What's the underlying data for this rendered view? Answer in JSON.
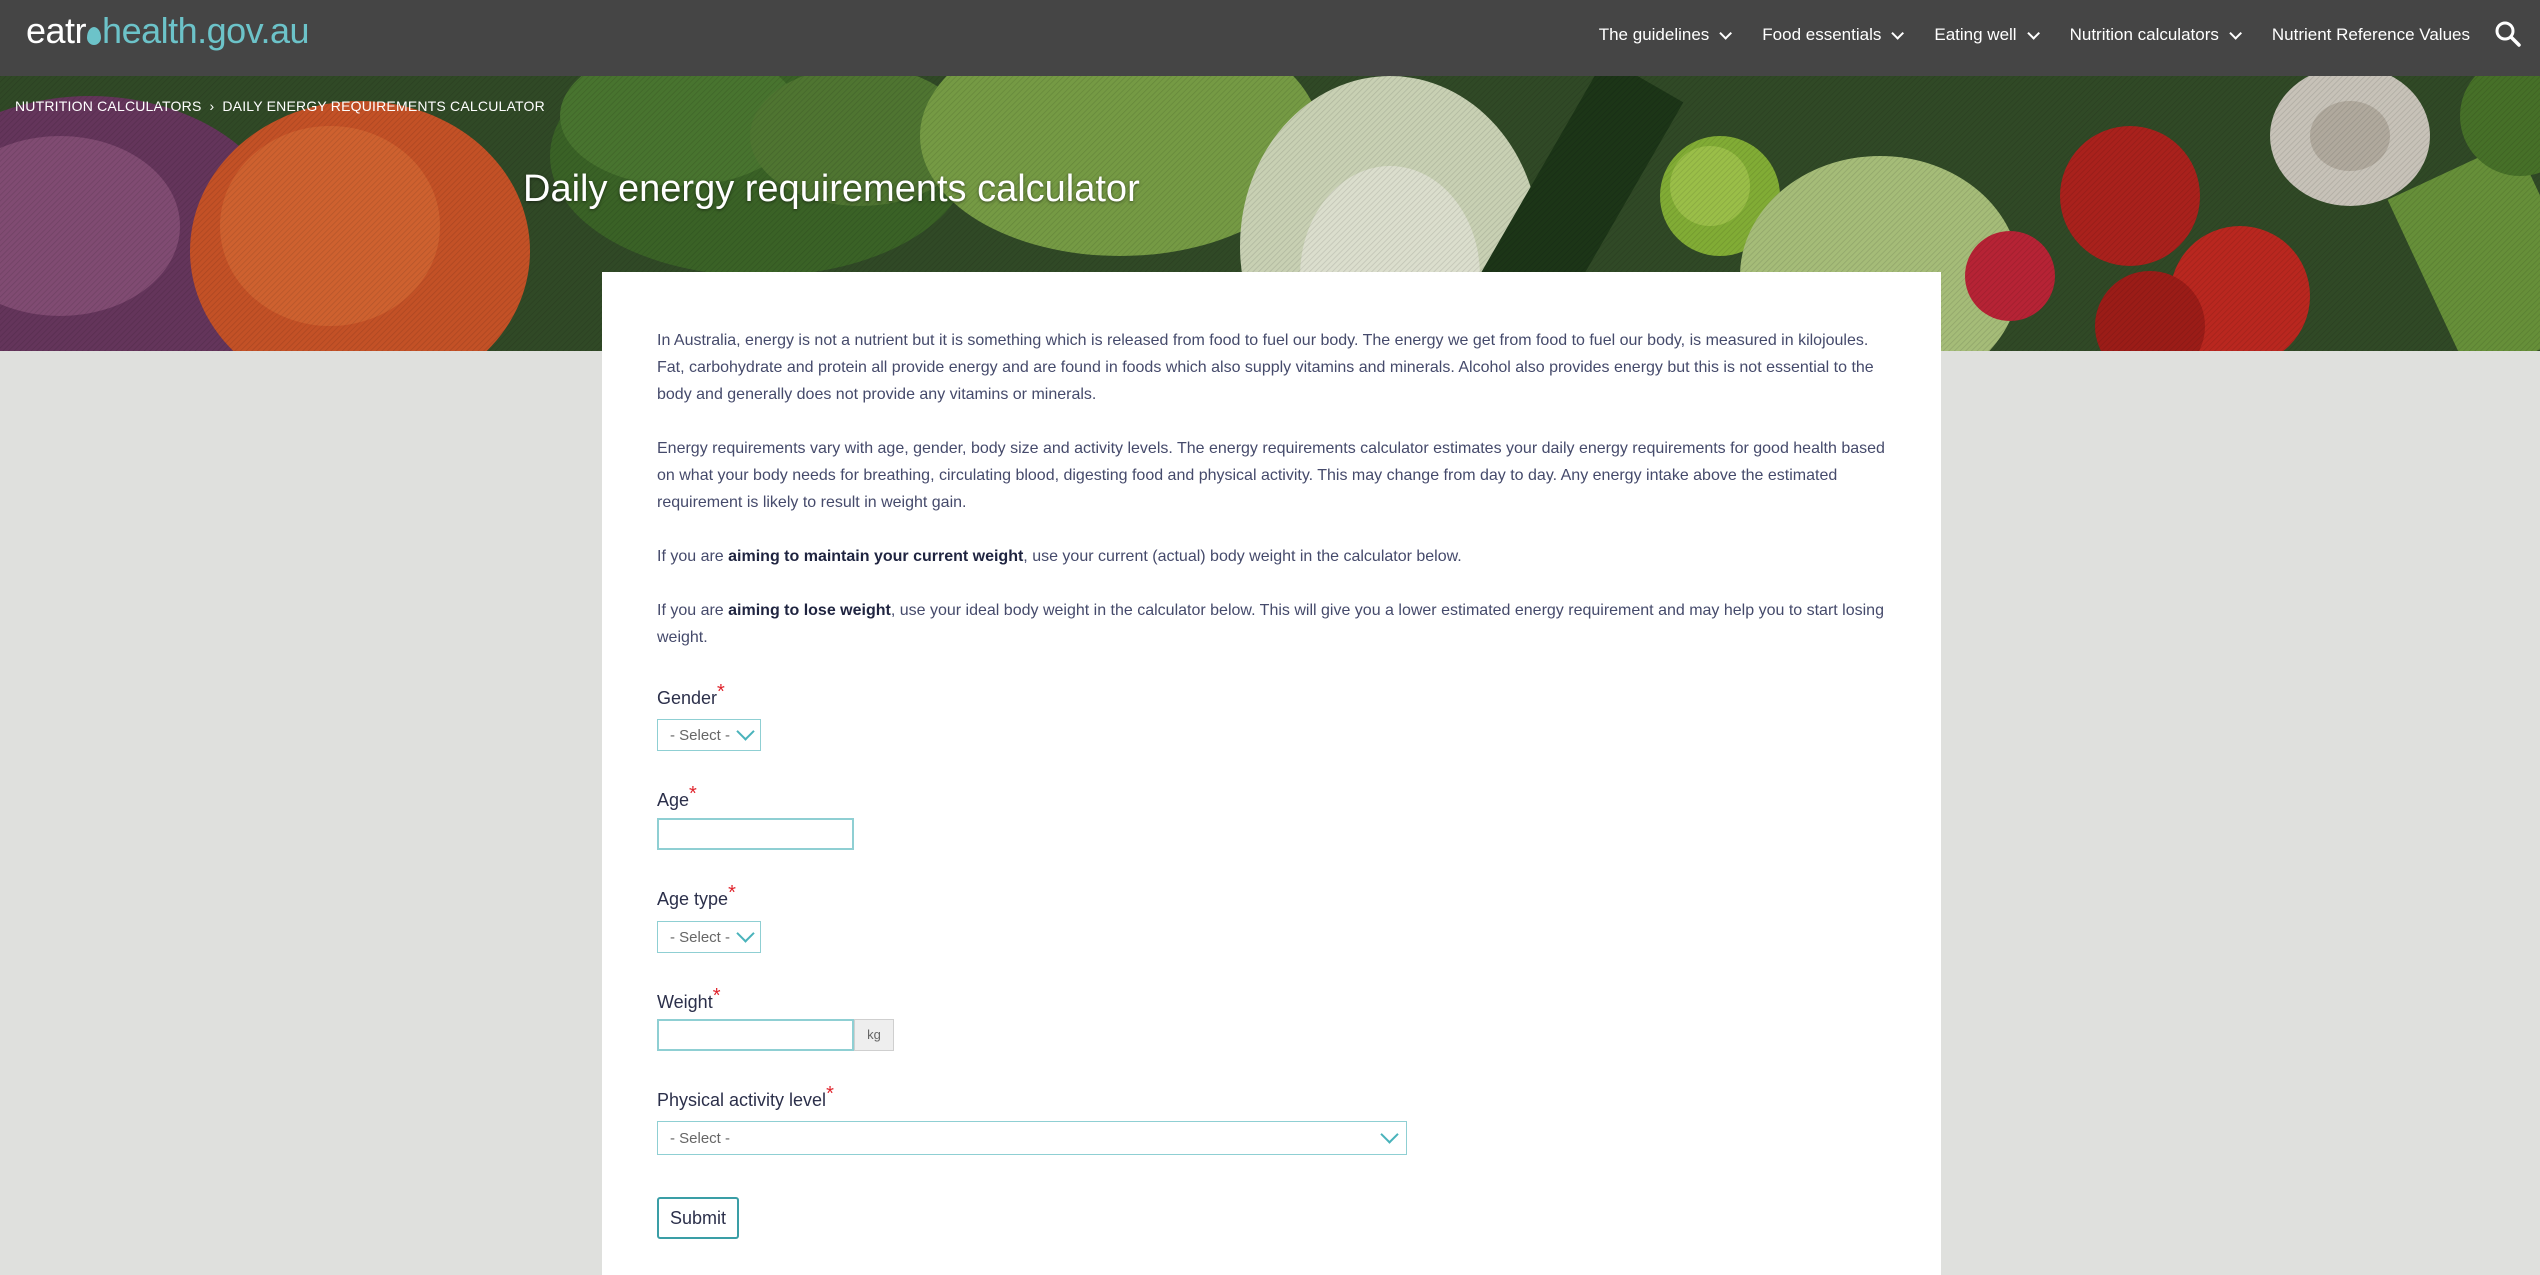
{
  "logo": {
    "part1": "eat",
    "part2": "r",
    "part3": "health.gov.au"
  },
  "nav": {
    "items": [
      {
        "label": "The guidelines"
      },
      {
        "label": "Food essentials"
      },
      {
        "label": "Eating well"
      },
      {
        "label": "Nutrition calculators"
      },
      {
        "label": "Nutrient Reference Values"
      }
    ],
    "search_icon": "search-icon"
  },
  "breadcrumb": {
    "items": [
      "NUTRITION CALCULATORS",
      "DAILY ENERGY REQUIREMENTS CALCULATOR"
    ],
    "separator": "›"
  },
  "page_title": "Daily energy requirements calculator",
  "intro": {
    "p1": "In Australia, energy is not a nutrient but it is something which is released from food to fuel our body. The energy we get from food to fuel our body, is measured in kilojoules. Fat, carbohydrate and protein all provide energy and are found in foods which also supply vitamins and minerals. Alcohol also provides energy but this is not essential to the body and generally does not provide any vitamins or minerals.",
    "p2": "Energy requirements vary with age, gender, body size and activity levels. The energy requirements calculator estimates your daily energy requirements for good health based on what your body needs for breathing, circulating blood, digesting food and physical activity. This may change from day to day. Any energy intake above the estimated requirement is likely to result in weight gain.",
    "p3_pre": "If you are ",
    "p3_bold": "aiming to maintain your current weight",
    "p3_post": ", use your current (actual) body weight in the calculator below.",
    "p4_pre": "If you are ",
    "p4_bold": "aiming to lose weight",
    "p4_post": ", use your ideal body weight in the calculator below. This will give you a lower estimated energy requirement and may help you to start losing weight."
  },
  "form": {
    "required_mark": "*",
    "gender": {
      "label": "Gender",
      "value": "- Select -"
    },
    "age": {
      "label": "Age",
      "value": ""
    },
    "age_type": {
      "label": "Age type",
      "value": "- Select -"
    },
    "weight": {
      "label": "Weight",
      "value": "",
      "unit": "kg"
    },
    "activity": {
      "label": "Physical activity level",
      "value": "- Select -"
    },
    "submit_label": "Submit"
  },
  "colors": {
    "topbar": "#454545",
    "accent": "#6cc3c9",
    "required": "#e0232c",
    "page_bg": "#dfe0dd"
  }
}
